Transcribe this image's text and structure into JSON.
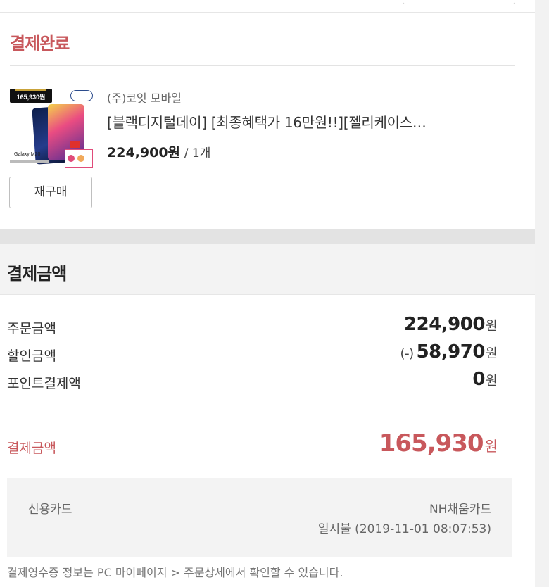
{
  "order_status": {
    "title": "결제완료"
  },
  "product": {
    "thumbnail_price_badge": "165,930원",
    "thumbnail_model": "Galaxy M20",
    "seller": "(주)코잇 모바일",
    "name": "[블랙디지털데이] [최종혜택가 16만원!!][젤리케이스…",
    "price": "224,900원",
    "quantity": "/ 1개",
    "rebuy_label": "재구매"
  },
  "payment": {
    "title": "결제금액",
    "rows": [
      {
        "label": "주문금액",
        "prefix": "",
        "amount": "224,900",
        "unit": "원"
      },
      {
        "label": "할인금액",
        "prefix": "(-)",
        "amount": "58,970",
        "unit": "원"
      },
      {
        "label": "포인트결제액",
        "prefix": "",
        "amount": "0",
        "unit": "원"
      }
    ],
    "total_label": "결제금액",
    "total_amount": "165,930",
    "total_unit": "원",
    "method": {
      "type": "신용카드",
      "card_name": "NH채움카드",
      "detail": "일시불 (2019-11-01 08:07:53)"
    },
    "notice": "결제영수증 정보는 PC 마이페이지 > 주문상세에서 확인할 수 있습니다."
  },
  "colors": {
    "accent_red": "#c8585c",
    "panel_gray": "#f3f3f3"
  }
}
